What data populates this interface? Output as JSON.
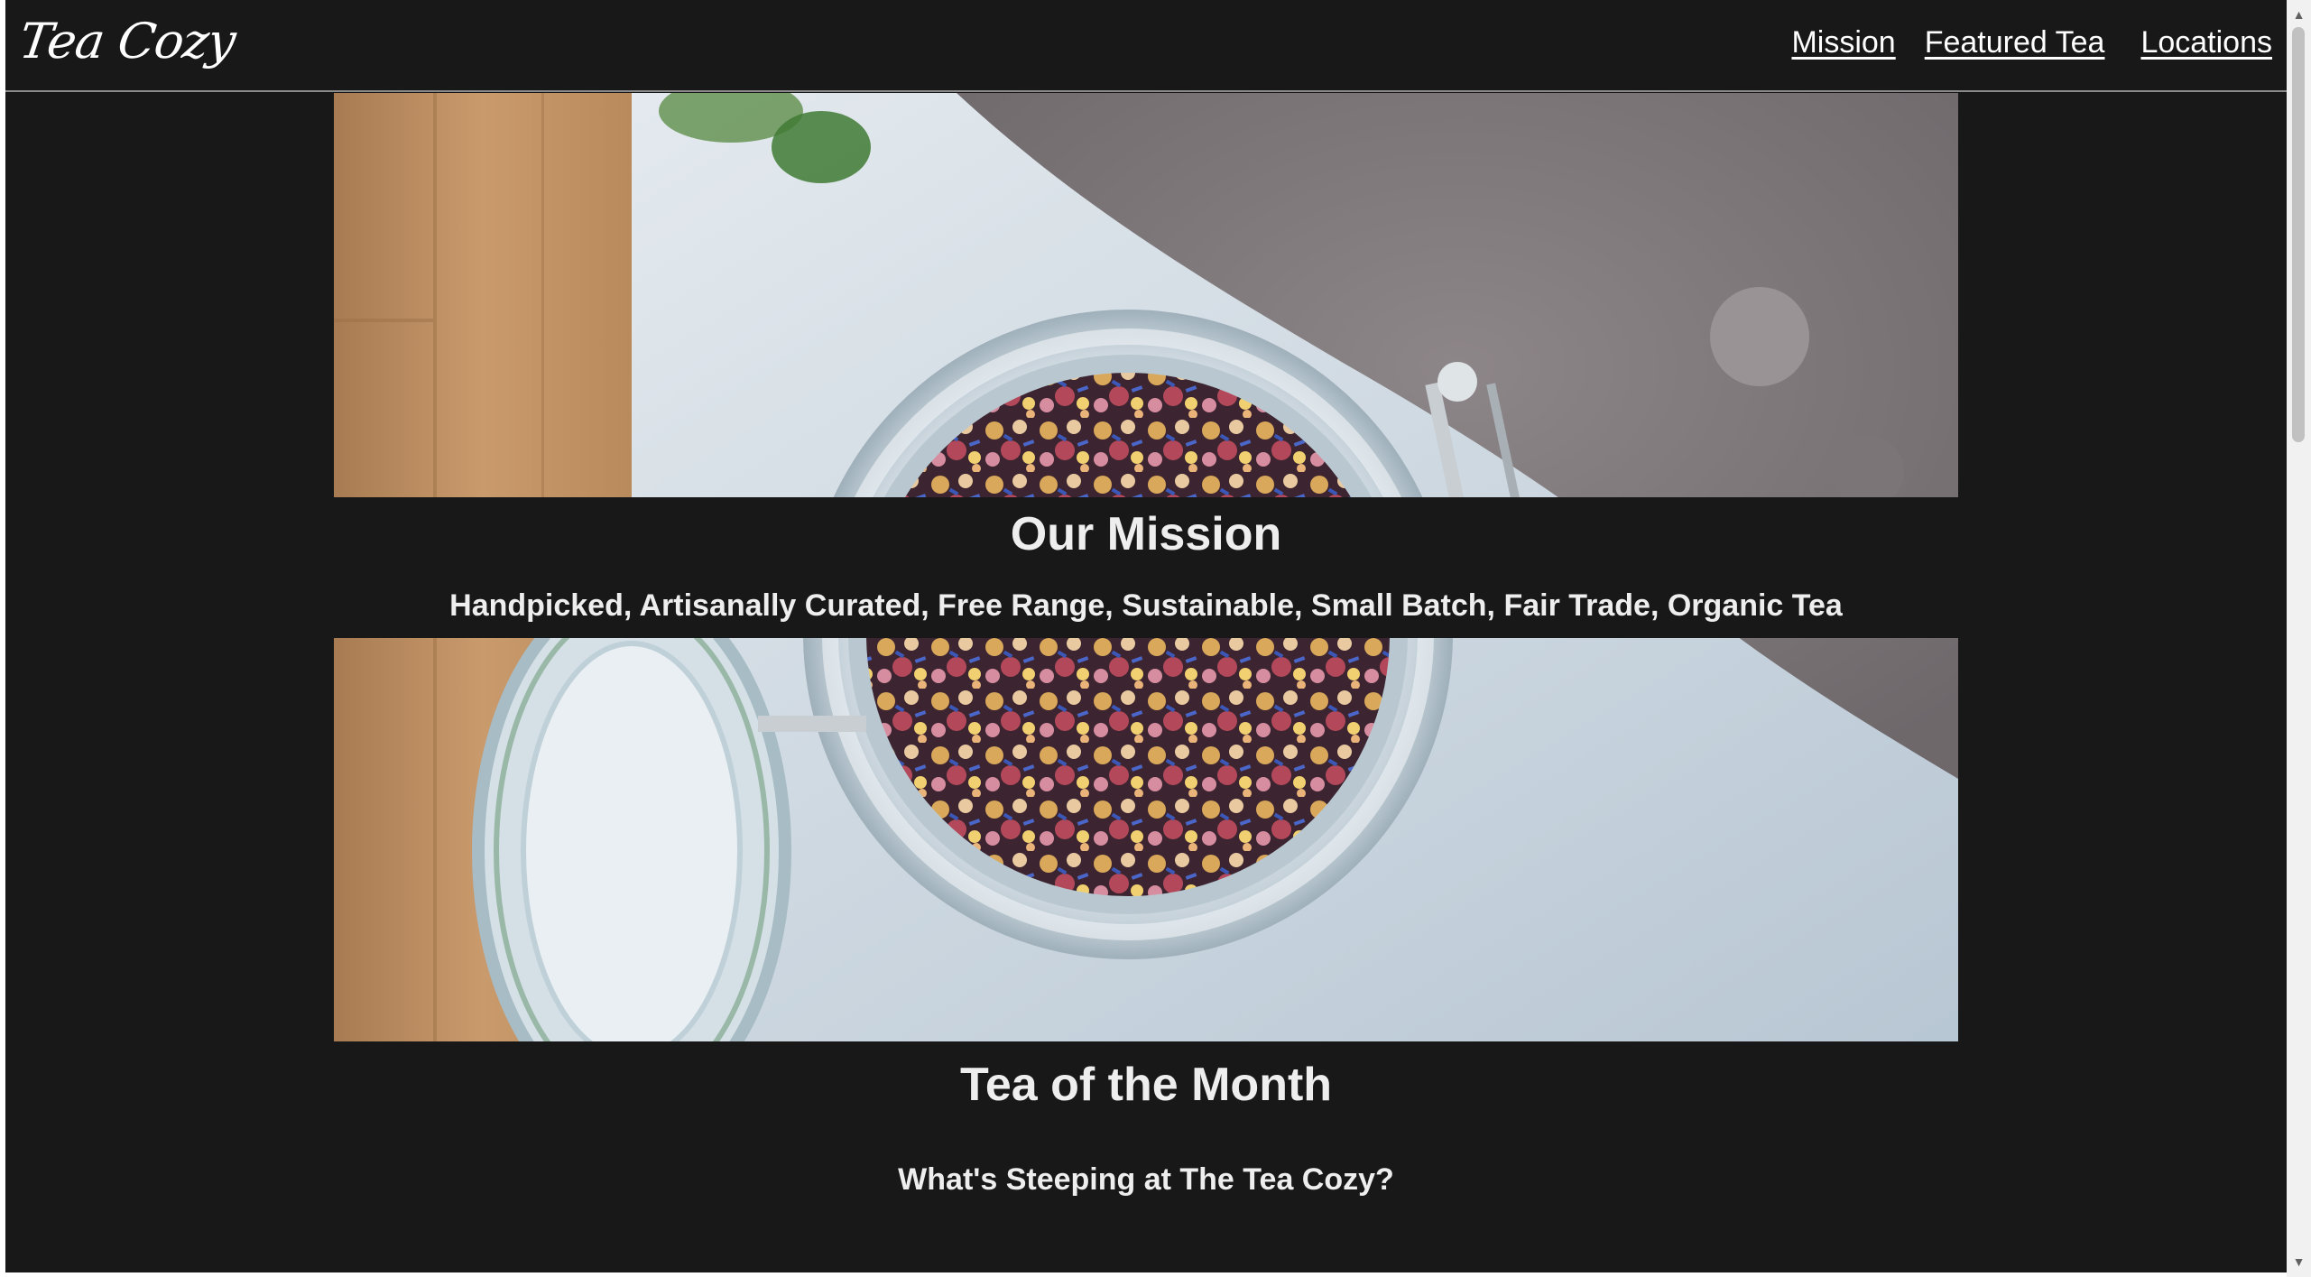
{
  "header": {
    "logo": "Tea Cozy",
    "nav": [
      {
        "label": "Mission"
      },
      {
        "label": "Featured Tea"
      },
      {
        "label": "Locations"
      }
    ]
  },
  "mission": {
    "title": "Our Mission",
    "subtitle": "Handpicked, Artisanally Curated, Free Range, Sustainable, Small Batch, Fair Trade, Organic Tea"
  },
  "featured": {
    "title": "Tea of the Month",
    "subtitle": "What's Steeping at The Tea Cozy?"
  },
  "scrollbar": {
    "up_icon": "▲",
    "down_icon": "▼"
  },
  "colors": {
    "background": "#181818",
    "text": "#eeeeee",
    "header_border": "#8a8a8a"
  }
}
